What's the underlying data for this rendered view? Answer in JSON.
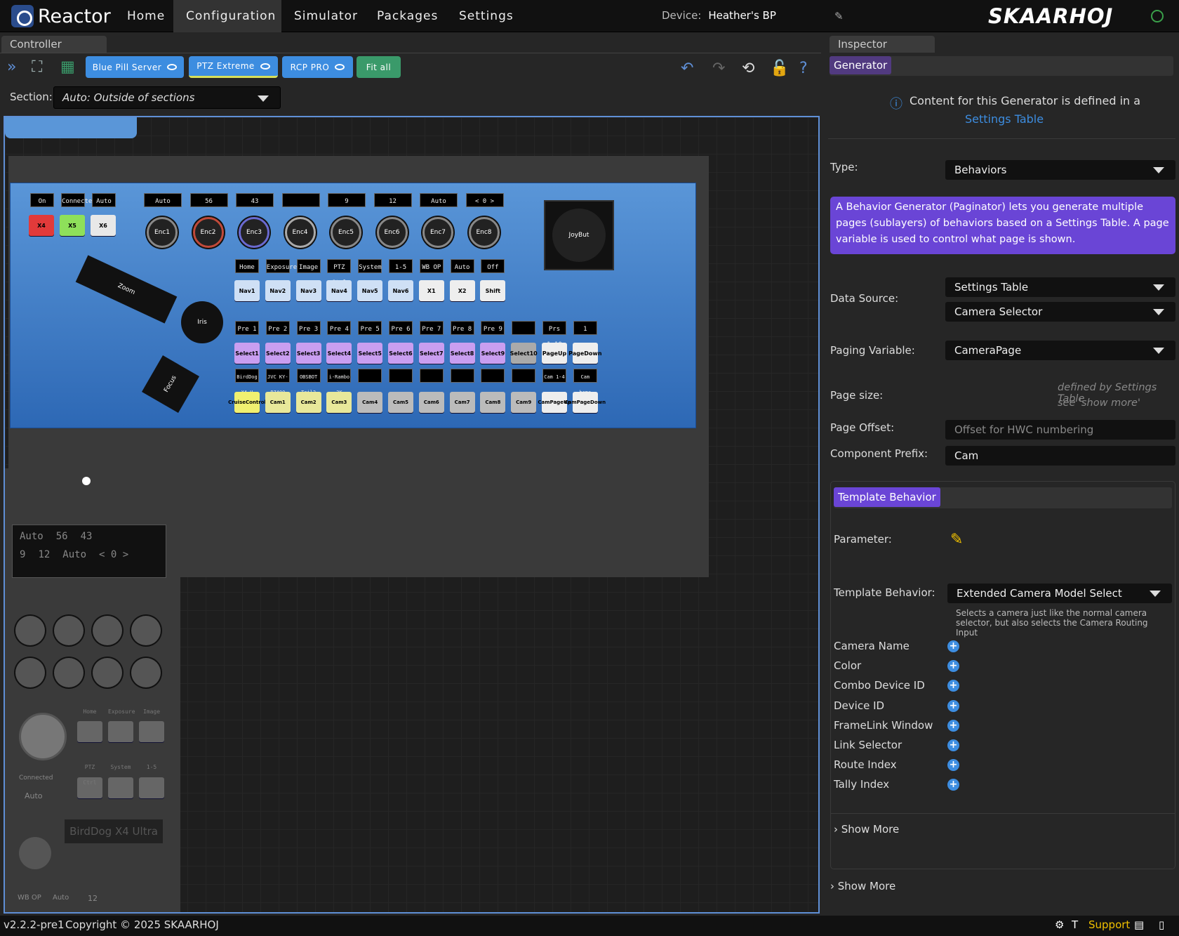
{
  "app": {
    "title": "Reactor",
    "brand": "SKAARHOJ"
  },
  "nav": [
    "Home",
    "Configuration",
    "Simulator",
    "Packages",
    "Settings"
  ],
  "device": {
    "label": "Device:",
    "name": "Heather's BP"
  },
  "controller_tab": "Controller",
  "inspector_tab": "Inspector",
  "toolbar": {
    "pills": [
      "Blue Pill Server",
      "PTZ Extreme",
      "RCP PRO"
    ],
    "fit_all": "Fit all"
  },
  "section": {
    "label": "Section:",
    "value": "Auto: Outside of sections"
  },
  "panel": {
    "top_displays": [
      [
        "On",
        "Connected",
        "Auto"
      ]
    ],
    "xbuttons": [
      "X4",
      "X5",
      "X6"
    ],
    "enc_displays": [
      "Auto",
      "56",
      "43",
      "",
      "9",
      "12",
      "Auto",
      "< 0 >"
    ],
    "encoders": [
      "Enc1",
      "Enc2",
      "Enc3",
      "Enc4",
      "Enc5",
      "Enc6",
      "Enc7",
      "Enc8"
    ],
    "joystick": "JoyBut",
    "zoom": "Zoom",
    "iris": "Iris",
    "focus": "Focus",
    "nav_displays": [
      "Home",
      "Exposure",
      "Image",
      "PTZ Ctrl",
      "System",
      "1-5",
      "WB OP",
      "Auto",
      "Off"
    ],
    "nav_buttons": [
      "Nav1",
      "Nav2",
      "Nav3",
      "Nav4",
      "Nav5",
      "Nav6",
      "X1",
      "X2",
      "Shift"
    ],
    "pre_displays": [
      "Pre 1",
      "Pre 2",
      "Pre 3",
      "Pre 4",
      "Pre 5",
      "Pre 6",
      "Pre 7",
      "Pre 8",
      "Pre 9",
      "",
      "Prs 1-10",
      "1"
    ],
    "select_buttons": [
      "Select1",
      "Select2",
      "Select3",
      "Select4",
      "Select5",
      "Select6",
      "Select7",
      "Select8",
      "Select9",
      "Select10",
      "PageUp",
      "PageDown"
    ],
    "cam_displays": [
      "BirdDog X4 U",
      "JVC KY-PZ400",
      "OBSBOT Tail2",
      "i-Rambo 3K",
      "",
      "",
      "",
      "",
      "",
      "",
      "Cam 1-4",
      "Cam home"
    ],
    "cam_buttons": [
      "CruiseControl",
      "Cam1",
      "Cam2",
      "Cam3",
      "Cam4",
      "Cam5",
      "Cam6",
      "Cam7",
      "Cam8",
      "Cam9",
      "CamPageUp",
      "CamPageDown"
    ]
  },
  "lower_panel": {
    "display_rows": [
      [
        "Auto",
        "56",
        "43"
      ],
      [
        "9",
        "12",
        "Auto",
        "< 0 >"
      ]
    ],
    "nav_small": [
      "Home",
      "Exposure",
      "Image"
    ],
    "nav_small2": [
      "PTZ Ctrl",
      "System",
      "1-5"
    ],
    "connected": "Connected",
    "auto": "Auto",
    "model": "BirdDog X4 Ultra",
    "bottom": [
      "WB OP",
      "Auto",
      "12"
    ]
  },
  "inspector": {
    "generator_badge": "Generator",
    "info_text": "Content for this Generator is defined in a",
    "info_link": "Settings Table",
    "type_label": "Type:",
    "type_value": "Behaviors",
    "description": "A Behavior Generator (Paginator) lets you generate multiple pages (sublayers) of behaviors based on a Settings Table. A page variable is used to control what page is shown.",
    "data_source_label": "Data Source:",
    "data_source_1": "Settings Table",
    "data_source_2": "Camera Selector",
    "paging_label": "Paging Variable:",
    "paging_value": "CameraPage",
    "page_size_label": "Page size:",
    "page_size_hint_1": "defined by Settings Table",
    "page_size_hint_2": "see 'show more'",
    "page_offset_label": "Page Offset:",
    "page_offset_placeholder": "Offset for HWC numbering",
    "prefix_label": "Component Prefix:",
    "prefix_value": "Cam",
    "template_badge": "Template Behavior",
    "parameter_label": "Parameter:",
    "template_behavior_label": "Template Behavior:",
    "template_behavior_value": "Extended Camera Model Select",
    "template_desc": "Selects a camera just like the normal camera selector, but also selects the Camera Routing Input",
    "params": [
      "Camera Name",
      "Color",
      "Combo Device ID",
      "Device ID",
      "FrameLink Window",
      "Link Selector",
      "Route Index",
      "Tally Index"
    ],
    "show_more_inner": "Show More",
    "show_more_outer": "Show More"
  },
  "status": {
    "version": "v2.2.2-pre1",
    "copyright": "Copyright © 2025 SKAARHOJ",
    "support": "Support"
  },
  "colors": {
    "accent": "#3d8de0",
    "purple": "#7b4fe0",
    "pill_blue": "#3d8de0",
    "pill_green": "#3a9a6a"
  }
}
